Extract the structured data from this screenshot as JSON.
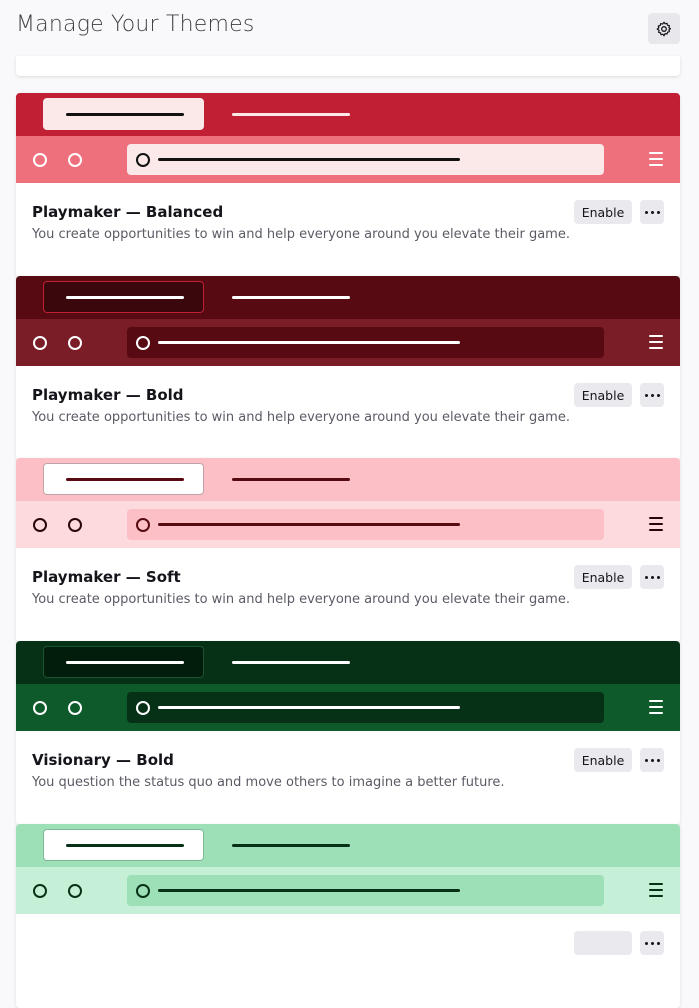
{
  "header": {
    "title": "Manage Your Themes",
    "settings_icon": "gear-icon"
  },
  "themes": [
    {
      "name": "Playmaker — Balanced",
      "description": "You create opportunities to win and help everyone around you elevate their game.",
      "enable_label": "Enable",
      "colors": {
        "tabbar": "#c11f33",
        "tab": "#fbe9ea",
        "tab_border": "#fbe9ea",
        "tab_line": "#111111",
        "tab_line2": "#fbe9ea",
        "toolbar": "#ef707d",
        "icons": "#ffffff",
        "urlbar": "#fbe9ea",
        "url_content": "#111111"
      }
    },
    {
      "name": "Playmaker — Bold",
      "description": "You create opportunities to win and help everyone around you elevate their game.",
      "enable_label": "Enable",
      "colors": {
        "tabbar": "#580a12",
        "tab": "#3a070c",
        "tab_border": "#c11f33",
        "tab_line": "#ffffff",
        "tab_line2": "#ffffff",
        "toolbar": "#7a1d27",
        "icons": "#ffffff",
        "urlbar": "#580a12",
        "url_content": "#ffffff"
      }
    },
    {
      "name": "Playmaker — Soft",
      "description": "You create opportunities to win and help everyone around you elevate their game.",
      "enable_label": "Enable",
      "colors": {
        "tabbar": "#fcbfc6",
        "tab": "#ffffff",
        "tab_border": "#bfa3a6",
        "tab_line": "#580a12",
        "tab_line2": "#580a12",
        "toolbar": "#fcdadd",
        "icons": "#2a0509",
        "urlbar": "#fcbfc6",
        "url_content": "#580a12"
      }
    },
    {
      "name": "Visionary — Bold",
      "description": "You question the status quo and move others to imagine a better future.",
      "enable_label": "Enable",
      "colors": {
        "tabbar": "#073117",
        "tab": "#031d0d",
        "tab_border": "#1c5132",
        "tab_line": "#ffffff",
        "tab_line2": "#ffffff",
        "toolbar": "#0e5a2b",
        "icons": "#ffffff",
        "urlbar": "#073117",
        "url_content": "#ffffff"
      }
    },
    {
      "name": "",
      "description": "",
      "enable_label": "",
      "colors": {
        "tabbar": "#9de0b8",
        "tab": "#ffffff",
        "tab_border": "#7fb898",
        "tab_line": "#073117",
        "tab_line2": "#073117",
        "toolbar": "#c6efd7",
        "icons": "#073117",
        "urlbar": "#9de0b8",
        "url_content": "#073117"
      }
    }
  ]
}
